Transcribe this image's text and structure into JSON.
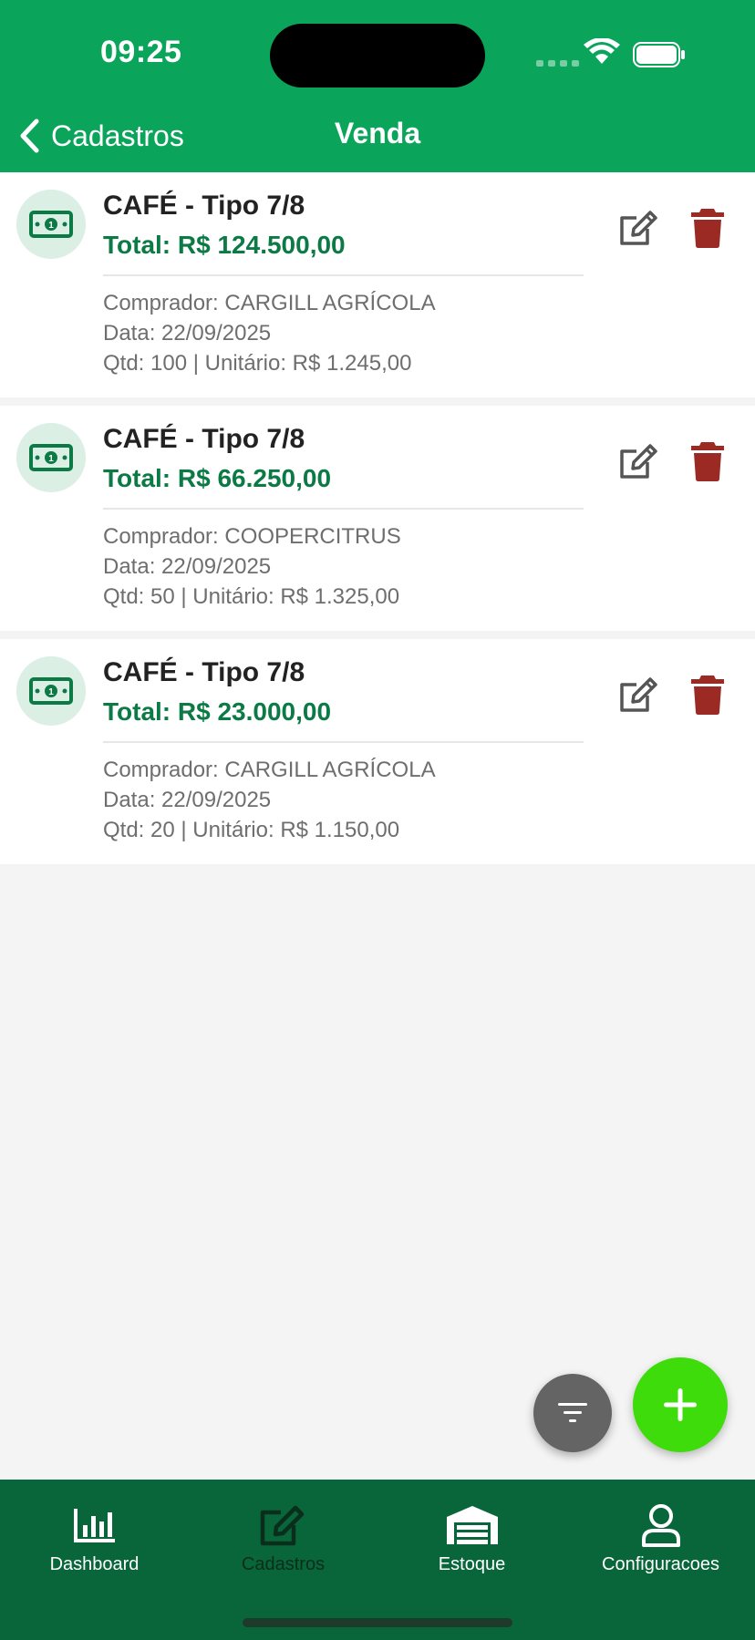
{
  "status_bar": {
    "time": "09:25"
  },
  "header": {
    "back_label": "Cadastros",
    "title": "Venda"
  },
  "sales": [
    {
      "title": "CAFÉ - Tipo 7/8",
      "total": "Total: R$ 124.500,00",
      "buyer": "Comprador: CARGILL AGRÍCOLA",
      "date": "Data: 22/09/2025",
      "qty_unit": "Qtd: 100 | Unitário: R$ 1.245,00"
    },
    {
      "title": "CAFÉ - Tipo 7/8",
      "total": "Total: R$ 66.250,00",
      "buyer": "Comprador: COOPERCITRUS",
      "date": "Data: 22/09/2025",
      "qty_unit": "Qtd: 50 | Unitário: R$ 1.325,00"
    },
    {
      "title": "CAFÉ - Tipo 7/8",
      "total": "Total: R$ 23.000,00",
      "buyer": "Comprador: CARGILL AGRÍCOLA",
      "date": "Data: 22/09/2025",
      "qty_unit": "Qtd: 20 | Unitário: R$ 1.150,00"
    }
  ],
  "icons": {
    "card": "money-bill-icon",
    "edit": "edit-icon",
    "delete": "trash-icon",
    "filter": "filter-icon",
    "add": "plus-icon"
  },
  "bottom_nav": [
    {
      "label": "Dashboard",
      "icon": "chart-bar-icon"
    },
    {
      "label": "Cadastros",
      "icon": "edit-icon",
      "active": true
    },
    {
      "label": "Estoque",
      "icon": "warehouse-icon"
    },
    {
      "label": "Configuracoes",
      "icon": "user-icon"
    }
  ],
  "colors": {
    "header": "#0aa55a",
    "nav": "#08663a",
    "total_text": "#0b7a44",
    "delete": "#9b2a24",
    "fab_add": "#3ddc0a",
    "fab_filter": "#646464"
  }
}
